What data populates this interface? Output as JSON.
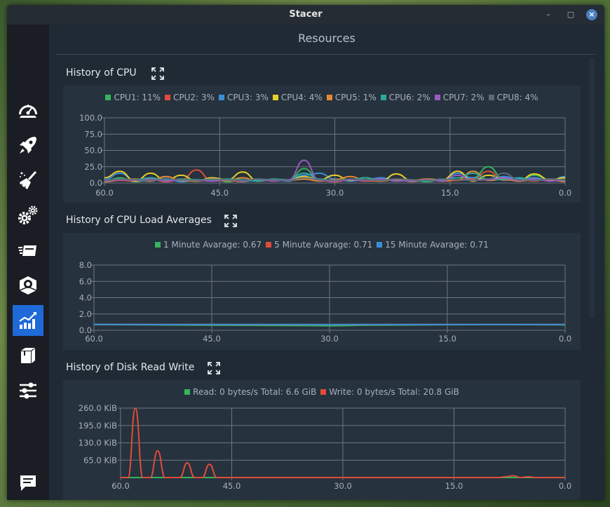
{
  "window": {
    "title": "Stacer"
  },
  "page": {
    "title": "Resources"
  },
  "sidebar": {
    "items": [
      {
        "name": "dashboard",
        "icon": "speedometer-icon",
        "active": false
      },
      {
        "name": "startup-apps",
        "icon": "rocket-icon",
        "active": false
      },
      {
        "name": "system-cleaner",
        "icon": "broom-icon",
        "active": false
      },
      {
        "name": "services",
        "icon": "gears-icon",
        "active": false
      },
      {
        "name": "processes",
        "icon": "processes-icon",
        "active": false
      },
      {
        "name": "uninstaller",
        "icon": "box-uninstall-icon",
        "active": false
      },
      {
        "name": "resources",
        "icon": "chart-icon",
        "active": true
      },
      {
        "name": "apt-repository",
        "icon": "package-icon",
        "active": false
      },
      {
        "name": "settings",
        "icon": "sliders-icon",
        "active": false
      },
      {
        "name": "feedback",
        "icon": "chat-icon",
        "active": false
      }
    ]
  },
  "sections": {
    "cpu": {
      "title": "History of CPU"
    },
    "load": {
      "title": "History of CPU Load Averages"
    },
    "disk": {
      "title": "History of Disk Read Write"
    }
  },
  "chart_data": [
    {
      "id": "cpu",
      "type": "line",
      "legend": [
        {
          "label": "CPU1: 11%",
          "color": "#36b35c"
        },
        {
          "label": "CPU2: 3%",
          "color": "#e04c3c"
        },
        {
          "label": "CPU3: 3%",
          "color": "#3b8fd6"
        },
        {
          "label": "CPU4: 4%",
          "color": "#e8cf2c"
        },
        {
          "label": "CPU5: 1%",
          "color": "#e38a34"
        },
        {
          "label": "CPU6: 2%",
          "color": "#2aa89a"
        },
        {
          "label": "CPU7: 2%",
          "color": "#9a5bc1"
        },
        {
          "label": "CPU8: 4%",
          "color": "#5a6b78"
        }
      ],
      "x": [
        60,
        58,
        56,
        54,
        52,
        50,
        48,
        46,
        44,
        42,
        40,
        38,
        36,
        34,
        32,
        30,
        28,
        26,
        24,
        22,
        20,
        18,
        16,
        14,
        12,
        10,
        8,
        6,
        4,
        2,
        0
      ],
      "series": [
        {
          "name": "CPU1",
          "color": "#36b35c",
          "values": [
            3,
            8,
            2,
            5,
            6,
            4,
            3,
            7,
            2,
            5,
            3,
            6,
            4,
            22,
            5,
            3,
            6,
            4,
            7,
            3,
            5,
            2,
            6,
            4,
            8,
            25,
            6,
            3,
            12,
            5,
            4
          ]
        },
        {
          "name": "CPU2",
          "color": "#e04c3c",
          "values": [
            2,
            4,
            3,
            6,
            2,
            5,
            20,
            3,
            4,
            2,
            6,
            3,
            5,
            8,
            4,
            2,
            5,
            3,
            4,
            6,
            2,
            5,
            3,
            4,
            6,
            18,
            4,
            5,
            3,
            6,
            2
          ]
        },
        {
          "name": "CPU3",
          "color": "#3b8fd6",
          "values": [
            5,
            15,
            4,
            3,
            7,
            2,
            5,
            4,
            6,
            3,
            4,
            5,
            3,
            12,
            15,
            6,
            3,
            5,
            8,
            4,
            3,
            5,
            4,
            15,
            8,
            5,
            10,
            6,
            8,
            3,
            10
          ]
        },
        {
          "name": "CPU4",
          "color": "#e8cf2c",
          "values": [
            8,
            18,
            3,
            15,
            4,
            12,
            3,
            8,
            5,
            17,
            3,
            6,
            4,
            10,
            5,
            12,
            4,
            8,
            3,
            14,
            4,
            6,
            5,
            18,
            3,
            12,
            6,
            4,
            14,
            5,
            8
          ]
        },
        {
          "name": "CPU5",
          "color": "#e38a34",
          "values": [
            2,
            5,
            6,
            3,
            10,
            4,
            3,
            5,
            4,
            8,
            3,
            5,
            4,
            6,
            3,
            5,
            10,
            4,
            3,
            5,
            4,
            6,
            3,
            5,
            18,
            4,
            6,
            3,
            5,
            4,
            3
          ]
        },
        {
          "name": "CPU6",
          "color": "#2aa89a",
          "values": [
            4,
            6,
            5,
            8,
            4,
            6,
            5,
            4,
            6,
            5,
            3,
            6,
            5,
            15,
            6,
            4,
            5,
            8,
            4,
            6,
            5,
            3,
            5,
            8,
            15,
            6,
            5,
            8,
            4,
            6,
            4
          ]
        },
        {
          "name": "CPU7",
          "color": "#9a5bc1",
          "values": [
            3,
            5,
            4,
            6,
            3,
            5,
            4,
            3,
            5,
            4,
            6,
            3,
            5,
            35,
            4,
            3,
            5,
            4,
            6,
            3,
            4,
            5,
            3,
            12,
            4,
            5,
            8,
            4,
            6,
            3,
            5
          ]
        },
        {
          "name": "CPU8",
          "color": "#5a6b78",
          "values": [
            4,
            6,
            5,
            4,
            6,
            5,
            4,
            6,
            5,
            4,
            6,
            5,
            4,
            8,
            5,
            4,
            6,
            5,
            4,
            6,
            5,
            4,
            6,
            5,
            4,
            6,
            15,
            5,
            4,
            6,
            5
          ]
        }
      ],
      "ylim": [
        0,
        100
      ],
      "yticks": [
        "100.0",
        "75.0",
        "50.0",
        "25.0",
        "0.0"
      ],
      "xticks": [
        "60.0",
        "45.0",
        "30.0",
        "15.0",
        "0.0"
      ]
    },
    {
      "id": "load",
      "type": "line",
      "legend": [
        {
          "label": "1 Minute Avarage: 0.67",
          "color": "#36b35c"
        },
        {
          "label": "5 Minute Avarage: 0.71",
          "color": "#e04c3c"
        },
        {
          "label": "15 Minute Avarage: 0.71",
          "color": "#3b8fd6"
        }
      ],
      "x": [
        60,
        55,
        50,
        45,
        40,
        35,
        30,
        25,
        20,
        15,
        10,
        5,
        0
      ],
      "series": [
        {
          "name": "1 Minute Avarage",
          "color": "#36b35c",
          "values": [
            0.7,
            0.68,
            0.65,
            0.62,
            0.6,
            0.58,
            0.55,
            0.62,
            0.65,
            0.68,
            0.7,
            0.69,
            0.67
          ]
        },
        {
          "name": "5 Minute Avarage",
          "color": "#e04c3c",
          "values": [
            0.72,
            0.72,
            0.71,
            0.71,
            0.7,
            0.7,
            0.7,
            0.7,
            0.71,
            0.71,
            0.71,
            0.71,
            0.71
          ]
        },
        {
          "name": "15 Minute Avarage",
          "color": "#3b8fd6",
          "values": [
            0.72,
            0.72,
            0.71,
            0.71,
            0.71,
            0.71,
            0.7,
            0.71,
            0.71,
            0.71,
            0.71,
            0.71,
            0.71
          ]
        }
      ],
      "ylim": [
        0,
        8
      ],
      "yticks": [
        "8.0",
        "6.0",
        "4.0",
        "2.0",
        "0.0"
      ],
      "xticks": [
        "60.0",
        "45.0",
        "30.0",
        "15.0",
        "0.0"
      ]
    },
    {
      "id": "disk",
      "type": "line",
      "legend": [
        {
          "label": "Read: 0 bytes/s Total: 6.6 GiB",
          "color": "#36b35c"
        },
        {
          "label": "Write: 0 bytes/s Total: 20.8 GiB",
          "color": "#e04c3c"
        }
      ],
      "x": [
        60,
        59,
        58,
        57,
        56,
        55,
        54,
        53,
        52,
        51,
        50,
        49,
        48,
        47,
        46,
        45,
        44,
        40,
        35,
        30,
        25,
        20,
        15,
        12,
        10,
        9,
        8,
        7,
        6,
        5,
        4,
        0
      ],
      "series": [
        {
          "name": "Read",
          "color": "#36b35c",
          "values": [
            0,
            0,
            0,
            0,
            0,
            0,
            0,
            0,
            0,
            0,
            0,
            0,
            0,
            0,
            0,
            0,
            0,
            0,
            0,
            0,
            0,
            0,
            0,
            0,
            0,
            0,
            0,
            0,
            0,
            0,
            0,
            0
          ]
        },
        {
          "name": "Write",
          "color": "#e04c3c",
          "values": [
            0,
            0,
            260,
            0,
            0,
            100,
            0,
            0,
            0,
            55,
            0,
            0,
            50,
            0,
            0,
            0,
            0,
            0,
            0,
            0,
            0,
            0,
            0,
            0,
            0,
            0,
            3,
            7,
            0,
            3,
            0,
            0
          ]
        }
      ],
      "ylim": [
        0,
        260
      ],
      "yticks": [
        "260.0 KiB",
        "195.0 KiB",
        "130.0 KiB",
        "65.0 KiB"
      ],
      "xticks": [
        "60.0",
        "45.0",
        "30.0",
        "15.0",
        "0.0"
      ]
    }
  ]
}
